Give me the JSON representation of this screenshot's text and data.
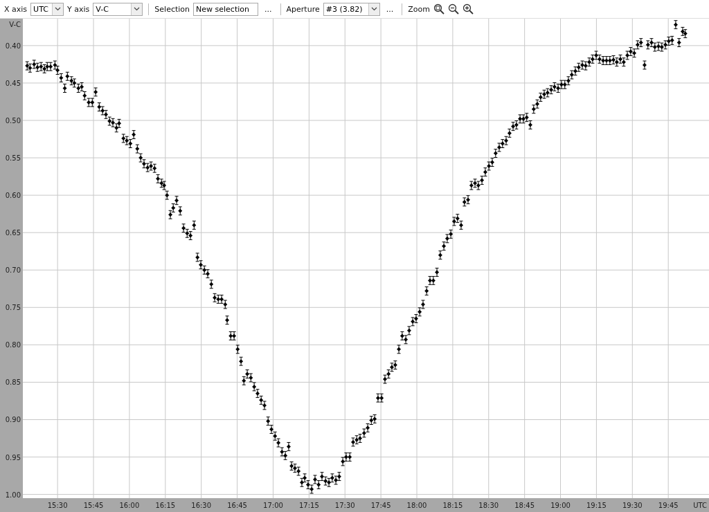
{
  "toolbar": {
    "x_axis": {
      "label": "X axis",
      "value": "UTC"
    },
    "y_axis": {
      "label": "Y axis",
      "value": "V-C"
    },
    "selection": {
      "label": "Selection",
      "value": "New selection",
      "more": "..."
    },
    "aperture": {
      "label": "Aperture",
      "value": "#3 (3.82)",
      "more": "..."
    },
    "zoom": {
      "label": "Zoom"
    }
  },
  "chart_data": {
    "type": "scatter",
    "xlabel": "UTC",
    "ylabel": "V-C",
    "grid": true,
    "xlim": [
      915.5,
      1202
    ],
    "ylim": [
      1.005,
      0.364
    ],
    "xticks": [
      {
        "value": 930,
        "label": "15:30"
      },
      {
        "value": 945,
        "label": "15:45"
      },
      {
        "value": 960,
        "label": "16:00"
      },
      {
        "value": 975,
        "label": "16:15"
      },
      {
        "value": 990,
        "label": "16:30"
      },
      {
        "value": 1005,
        "label": "16:45"
      },
      {
        "value": 1020,
        "label": "17:00"
      },
      {
        "value": 1035,
        "label": "17:15"
      },
      {
        "value": 1050,
        "label": "17:30"
      },
      {
        "value": 1065,
        "label": "17:45"
      },
      {
        "value": 1080,
        "label": "18:00"
      },
      {
        "value": 1095,
        "label": "18:15"
      },
      {
        "value": 1110,
        "label": "18:30"
      },
      {
        "value": 1125,
        "label": "18:45"
      },
      {
        "value": 1140,
        "label": "19:00"
      },
      {
        "value": 1155,
        "label": "19:15"
      },
      {
        "value": 1170,
        "label": "19:30"
      },
      {
        "value": 1185,
        "label": "19:45"
      }
    ],
    "yticks": [
      {
        "value": 0.4,
        "label": "0.40"
      },
      {
        "value": 0.45,
        "label": "0.45"
      },
      {
        "value": 0.5,
        "label": "0.50"
      },
      {
        "value": 0.55,
        "label": "0.55"
      },
      {
        "value": 0.6,
        "label": "0.60"
      },
      {
        "value": 0.65,
        "label": "0.65"
      },
      {
        "value": 0.7,
        "label": "0.70"
      },
      {
        "value": 0.75,
        "label": "0.75"
      },
      {
        "value": 0.8,
        "label": "0.80"
      },
      {
        "value": 0.85,
        "label": "0.85"
      },
      {
        "value": 0.9,
        "label": "0.90"
      },
      {
        "value": 0.95,
        "label": "0.95"
      },
      {
        "value": 1.0,
        "label": "1.00"
      }
    ],
    "x": [
      917.3,
      918.5,
      920.2,
      921.6,
      923.1,
      924.5,
      925.7,
      927.1,
      928.9,
      930.0,
      931.5,
      933.0,
      934.1,
      935.8,
      937.0,
      938.7,
      940.1,
      941.3,
      943.0,
      944.5,
      945.9,
      947.4,
      948.8,
      950.2,
      951.7,
      953.1,
      954.6,
      955.7,
      957.5,
      958.9,
      960.4,
      961.8,
      963.3,
      964.7,
      966.1,
      967.6,
      969.0,
      970.5,
      971.9,
      973.4,
      974.5,
      975.7,
      977.1,
      978.3,
      979.7,
      981.2,
      982.6,
      984.1,
      985.5,
      987.0,
      988.4,
      989.8,
      991.3,
      992.7,
      994.2,
      995.6,
      997.1,
      998.5,
      1000.0,
      1000.8,
      1002.3,
      1003.7,
      1005.2,
      1006.6,
      1007.8,
      1009.2,
      1010.7,
      1012.1,
      1013.5,
      1015.0,
      1016.4,
      1017.9,
      1019.3,
      1020.8,
      1022.2,
      1023.7,
      1025.1,
      1026.5,
      1027.7,
      1029.1,
      1030.6,
      1032.0,
      1033.2,
      1034.6,
      1036.1,
      1037.5,
      1039.0,
      1040.4,
      1041.9,
      1043.3,
      1044.7,
      1046.2,
      1047.6,
      1049.1,
      1050.5,
      1052.0,
      1053.4,
      1054.9,
      1056.3,
      1058.0,
      1059.5,
      1061.0,
      1062.4,
      1063.8,
      1065.3,
      1066.7,
      1068.2,
      1069.6,
      1071.0,
      1072.5,
      1073.9,
      1075.4,
      1076.8,
      1078.3,
      1079.7,
      1081.2,
      1082.6,
      1084.1,
      1085.5,
      1086.9,
      1088.4,
      1089.8,
      1091.3,
      1092.7,
      1094.2,
      1095.6,
      1097.0,
      1098.5,
      1099.9,
      1101.4,
      1102.8,
      1104.3,
      1105.7,
      1107.2,
      1108.6,
      1110.1,
      1111.5,
      1112.9,
      1114.4,
      1115.8,
      1117.3,
      1118.7,
      1120.2,
      1121.6,
      1123.1,
      1124.5,
      1125.9,
      1127.4,
      1128.8,
      1130.3,
      1131.7,
      1133.2,
      1134.6,
      1136.1,
      1137.5,
      1139.0,
      1140.4,
      1141.8,
      1143.3,
      1144.7,
      1146.2,
      1147.6,
      1149.1,
      1150.5,
      1152.0,
      1153.4,
      1154.9,
      1156.3,
      1157.8,
      1159.2,
      1160.6,
      1162.1,
      1163.5,
      1165.0,
      1166.4,
      1167.9,
      1169.3,
      1170.8,
      1172.2,
      1173.6,
      1175.1,
      1176.5,
      1178.0,
      1179.4,
      1180.9,
      1182.3,
      1183.8,
      1185.2,
      1186.6,
      1188.1,
      1189.5,
      1191.0,
      1192.1
    ],
    "series": [
      {
        "color": "#000000",
        "errors": [
          0.0055,
          0.0055,
          0.0055,
          0.0055,
          0.0055,
          0.0055,
          0.0055,
          0.0055,
          0.0055,
          0.0055,
          0.0055,
          0.0055,
          0.0055,
          0.0055,
          0.0055,
          0.0055,
          0.0055,
          0.0055,
          0.0055,
          0.0055,
          0.0055,
          0.0055,
          0.0055,
          0.0055,
          0.0055,
          0.0055,
          0.0055,
          0.0055,
          0.0055,
          0.0055,
          0.0055,
          0.0055,
          0.0055,
          0.0055,
          0.0055,
          0.0055,
          0.0055,
          0.0055,
          0.0055,
          0.0055,
          0.0055,
          0.0055,
          0.0055,
          0.0055,
          0.0055,
          0.0055,
          0.0055,
          0.0055,
          0.0055,
          0.0055,
          0.0055,
          0.0055,
          0.0055,
          0.0055,
          0.0055,
          0.0055,
          0.0055,
          0.0055,
          0.0055,
          0.0055,
          0.0055,
          0.0055,
          0.0055,
          0.0055,
          0.0055,
          0.0055,
          0.0055,
          0.0055,
          0.0055,
          0.0055,
          0.0055,
          0.0055,
          0.0055,
          0.0055,
          0.0055,
          0.0055,
          0.0055,
          0.0055,
          0.0055,
          0.0055,
          0.0055,
          0.0055,
          0.0055,
          0.0055,
          0.0055,
          0.0055,
          0.0055,
          0.0055,
          0.0055,
          0.0055,
          0.0055,
          0.0055,
          0.0055,
          0.0055,
          0.0055,
          0.0055,
          0.0055,
          0.0055,
          0.0055,
          0.0055,
          0.0055,
          0.0055,
          0.0055,
          0.0055,
          0.0055,
          0.0055,
          0.0055,
          0.0055,
          0.0055,
          0.0055,
          0.0055,
          0.0055,
          0.0055,
          0.0055,
          0.0055,
          0.0055,
          0.0055,
          0.0055,
          0.0055,
          0.0055,
          0.0055,
          0.0055,
          0.0055,
          0.0055,
          0.0055,
          0.0055,
          0.0055,
          0.0055,
          0.0055,
          0.0055,
          0.0055,
          0.0055,
          0.0055,
          0.0055,
          0.0055,
          0.0055,
          0.0055,
          0.0055,
          0.0055,
          0.0055,
          0.0055,
          0.0055,
          0.0055,
          0.0055,
          0.0055,
          0.0055,
          0.0055,
          0.0055,
          0.0055,
          0.0055,
          0.0055,
          0.0055,
          0.0055,
          0.0055,
          0.0055,
          0.0055,
          0.0055,
          0.0055,
          0.0055,
          0.0055,
          0.0055,
          0.0055,
          0.0055,
          0.0055,
          0.0055,
          0.0055,
          0.0055,
          0.0055,
          0.0055,
          0.0055,
          0.0055,
          0.0055,
          0.0055,
          0.0055,
          0.0055,
          0.0055,
          0.0055,
          0.0055,
          0.0055,
          0.0055,
          0.0055,
          0.0055,
          0.0055,
          0.0055,
          0.0055,
          0.0055,
          0.0055,
          0.0055,
          0.0055,
          0.0055,
          0.0055,
          0.0055,
          0.0055
        ],
        "values": [
          0.427,
          0.43,
          0.425,
          0.429,
          0.428,
          0.431,
          0.428,
          0.428,
          0.426,
          0.433,
          0.443,
          0.457,
          0.441,
          0.447,
          0.45,
          0.457,
          0.455,
          0.467,
          0.476,
          0.476,
          0.462,
          0.482,
          0.487,
          0.492,
          0.501,
          0.503,
          0.51,
          0.504,
          0.524,
          0.527,
          0.531,
          0.519,
          0.538,
          0.55,
          0.558,
          0.563,
          0.561,
          0.564,
          0.578,
          0.584,
          0.587,
          0.6,
          0.626,
          0.617,
          0.607,
          0.621,
          0.644,
          0.651,
          0.654,
          0.64,
          0.683,
          0.693,
          0.7,
          0.705,
          0.719,
          0.737,
          0.739,
          0.739,
          0.746,
          0.767,
          0.788,
          0.788,
          0.806,
          0.822,
          0.848,
          0.839,
          0.844,
          0.856,
          0.865,
          0.874,
          0.881,
          0.902,
          0.913,
          0.922,
          0.931,
          0.943,
          0.948,
          0.936,
          0.962,
          0.965,
          0.969,
          0.984,
          0.978,
          0.987,
          0.993,
          0.98,
          0.987,
          0.976,
          0.982,
          0.984,
          0.978,
          0.981,
          0.976,
          0.956,
          0.95,
          0.95,
          0.93,
          0.927,
          0.925,
          0.918,
          0.911,
          0.901,
          0.899,
          0.871,
          0.871,
          0.846,
          0.839,
          0.83,
          0.827,
          0.806,
          0.788,
          0.793,
          0.781,
          0.769,
          0.765,
          0.756,
          0.746,
          0.728,
          0.714,
          0.714,
          0.703,
          0.68,
          0.668,
          0.658,
          0.652,
          0.635,
          0.631,
          0.64,
          0.609,
          0.606,
          0.587,
          0.584,
          0.587,
          0.58,
          0.569,
          0.561,
          0.556,
          0.544,
          0.536,
          0.531,
          0.527,
          0.517,
          0.508,
          0.506,
          0.498,
          0.498,
          0.496,
          0.506,
          0.485,
          0.478,
          0.469,
          0.465,
          0.463,
          0.459,
          0.455,
          0.457,
          0.452,
          0.452,
          0.447,
          0.439,
          0.434,
          0.429,
          0.426,
          0.427,
          0.422,
          0.418,
          0.413,
          0.418,
          0.42,
          0.42,
          0.42,
          0.419,
          0.422,
          0.418,
          0.422,
          0.413,
          0.408,
          0.41,
          0.399,
          0.396,
          0.426,
          0.399,
          0.396,
          0.402,
          0.401,
          0.402,
          0.399,
          0.394,
          0.393,
          0.372,
          0.396,
          0.381,
          0.384
        ]
      }
    ]
  }
}
